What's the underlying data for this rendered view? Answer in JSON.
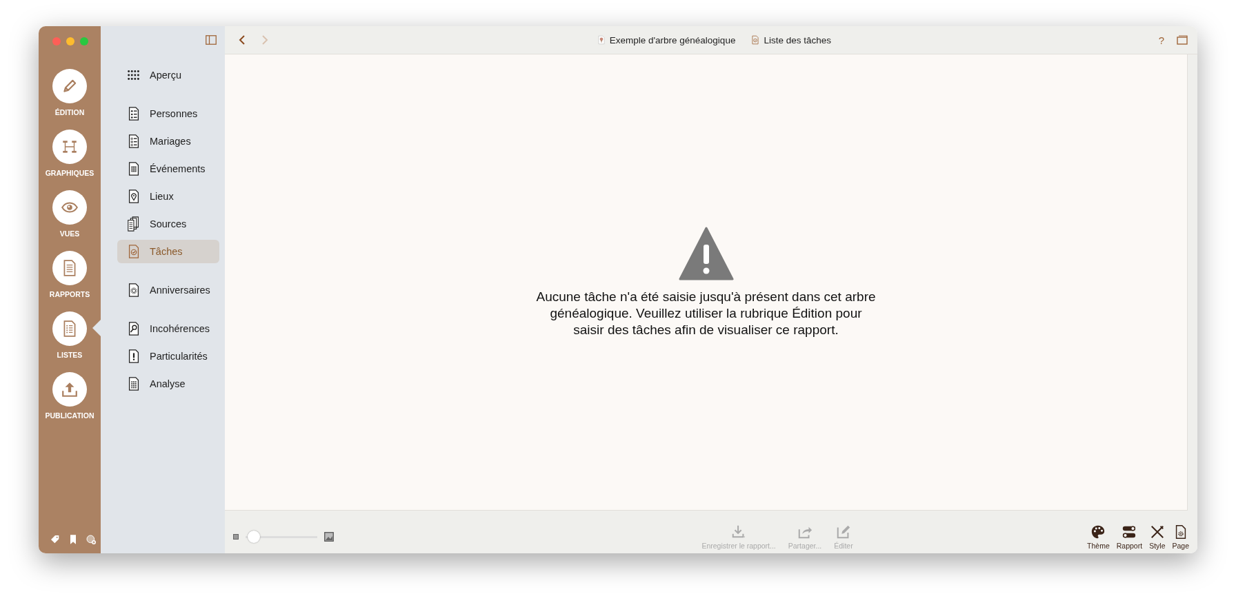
{
  "rail": {
    "items": [
      {
        "label": "ÉDITION",
        "selected": false
      },
      {
        "label": "GRAPHIQUES",
        "selected": false
      },
      {
        "label": "VUES",
        "selected": false
      },
      {
        "label": "RAPPORTS",
        "selected": false
      },
      {
        "label": "LISTES",
        "selected": true
      },
      {
        "label": "PUBLICATION",
        "selected": false
      }
    ]
  },
  "sidebar": {
    "groups": [
      [
        {
          "label": "Aperçu",
          "selected": false
        }
      ],
      [
        {
          "label": "Personnes",
          "selected": false
        },
        {
          "label": "Mariages",
          "selected": false
        },
        {
          "label": "Événements",
          "selected": false
        },
        {
          "label": "Lieux",
          "selected": false
        },
        {
          "label": "Sources",
          "selected": false
        },
        {
          "label": "Tâches",
          "selected": true
        }
      ],
      [
        {
          "label": "Anniversaires",
          "selected": false
        }
      ],
      [
        {
          "label": "Incohérences",
          "selected": false
        },
        {
          "label": "Particularités",
          "selected": false
        },
        {
          "label": "Analyse",
          "selected": false
        }
      ]
    ]
  },
  "toolbar": {
    "back": {
      "disabled": false
    },
    "forward": {
      "disabled": true
    },
    "breadcrumbs": [
      "Exemple d'arbre généalogique",
      "Liste des tâches"
    ],
    "help": "?"
  },
  "content": {
    "message": "Aucune tâche n'a été saisie jusqu'à présent dans cet arbre généalogique. Veuillez utiliser la rubrique Édition pour saisir des tâches afin de visualiser ce rapport."
  },
  "bottom_bar": {
    "zoom": {
      "level": 0.12
    },
    "actions": [
      {
        "label": "Enregistrer le rapport...",
        "disabled": true
      },
      {
        "label": "Partager...",
        "disabled": true
      },
      {
        "label": "Éditer",
        "disabled": true
      }
    ],
    "tools": [
      "Thème",
      "Rapport",
      "Style",
      "Page"
    ]
  }
}
